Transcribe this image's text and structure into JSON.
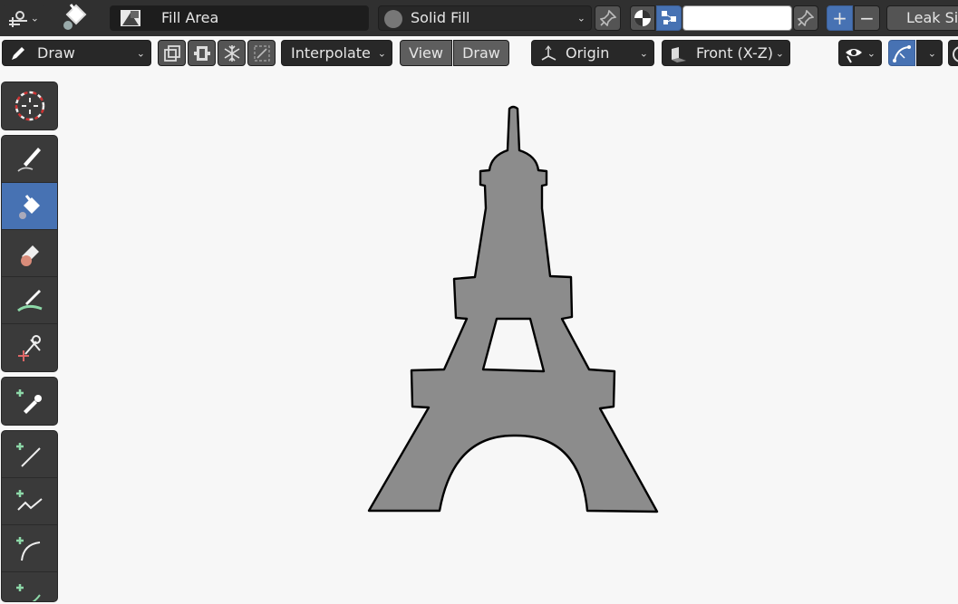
{
  "header": {
    "mode_icon": "grease-pencil-mode-icon",
    "active_tool_icon": "fill-bucket-icon",
    "brush_icon": "brush-preview-icon",
    "brush_name": "Fill Area",
    "material_icon": "material-sphere-icon",
    "material_name": "Solid Fill",
    "pin_icon": "pin-icon",
    "color_mode_icon": "color-mode-icon",
    "vertex_color_icon": "vertex-color-icon",
    "color_value": "",
    "add_label": "+",
    "remove_label": "−",
    "leak_size_label": "Leak Si"
  },
  "toolbar2": {
    "mode_label": "Draw",
    "interpolate_label": "Interpolate",
    "view_tab": "View",
    "draw_tab": "Draw",
    "origin_label": "Origin",
    "orientation_label": "Front (X-Z)",
    "overlay_icon": "visibility-eye-icon",
    "curve_icon": "curve-edit-icon"
  },
  "toolshelf": {
    "tools": [
      {
        "name": "cursor",
        "icon": "3d-cursor-icon",
        "active": false
      },
      {
        "name": "draw",
        "icon": "pencil-icon",
        "active": false
      },
      {
        "name": "fill",
        "icon": "fill-bucket-icon",
        "active": true
      },
      {
        "name": "erase",
        "icon": "eraser-icon",
        "active": false
      },
      {
        "name": "tint",
        "icon": "tint-brush-icon",
        "active": false
      },
      {
        "name": "cutter",
        "icon": "cutter-scissors-icon",
        "active": false
      },
      {
        "name": "eyedropper",
        "icon": "eyedropper-icon",
        "active": false
      },
      {
        "name": "line",
        "icon": "line-tool-icon",
        "active": false
      },
      {
        "name": "polyline",
        "icon": "polyline-tool-icon",
        "active": false
      },
      {
        "name": "arc",
        "icon": "arc-tool-icon",
        "active": false
      },
      {
        "name": "curve",
        "icon": "curve-tool-icon",
        "active": false
      }
    ]
  },
  "canvas": {
    "subject": "eiffel-tower-drawing",
    "fill_color": "#8c8c8c",
    "stroke_color": "#000000",
    "background_color": "#f7f7f7"
  }
}
